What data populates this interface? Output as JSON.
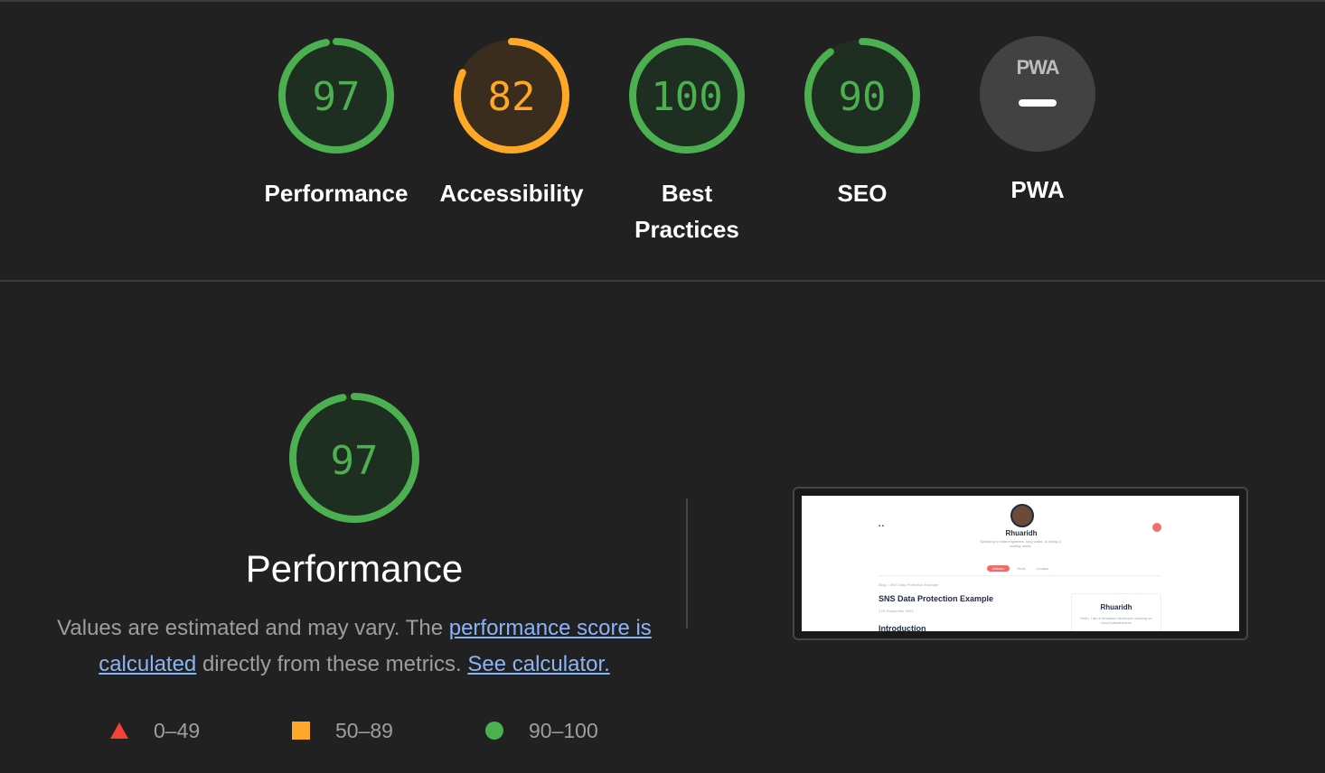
{
  "gauges": [
    {
      "score": "97",
      "label": "Performance",
      "value": 97,
      "color": "#4caf50",
      "fill": "#1e2e20"
    },
    {
      "score": "82",
      "label": "Accessibility",
      "value": 82,
      "color": "#ffa726",
      "fill": "#3a2d1d"
    },
    {
      "score": "100",
      "label": "Best Practices",
      "value": 100,
      "color": "#4caf50",
      "fill": "#1e2e20"
    },
    {
      "score": "90",
      "label": "SEO",
      "value": 90,
      "color": "#4caf50",
      "fill": "#1e2e20"
    }
  ],
  "pwa": {
    "logo": "PWA",
    "label": "PWA"
  },
  "performance_section": {
    "score": "97",
    "value": 97,
    "title": "Performance",
    "desc_prefix": "Values are estimated and may vary. The ",
    "desc_link1": "performance score is calculated",
    "desc_middle": " directly from these metrics. ",
    "desc_link2": "See calculator."
  },
  "legend": [
    {
      "range": "0–49",
      "shape": "triangle",
      "color": "#f44336"
    },
    {
      "range": "50–89",
      "shape": "square",
      "color": "#ffa726"
    },
    {
      "range": "90–100",
      "shape": "circle",
      "color": "#4caf50"
    }
  ],
  "screenshot": {
    "site_name": "Rhuaridh",
    "tagline": "Speaking to data engineers, long walks, & hiking & tooling nerds",
    "nav": [
      "Articles",
      "Tools",
      "Contact"
    ],
    "breadcrumb": "Blog > SNS Data Protection Example",
    "post_title": "SNS Data Protection Example",
    "post_date": "27th September 2023",
    "post_heading": "Introduction",
    "card_name": "Rhuaridh",
    "card_text": "Hello, I am a freelance developer working on cloud infrastructure"
  }
}
